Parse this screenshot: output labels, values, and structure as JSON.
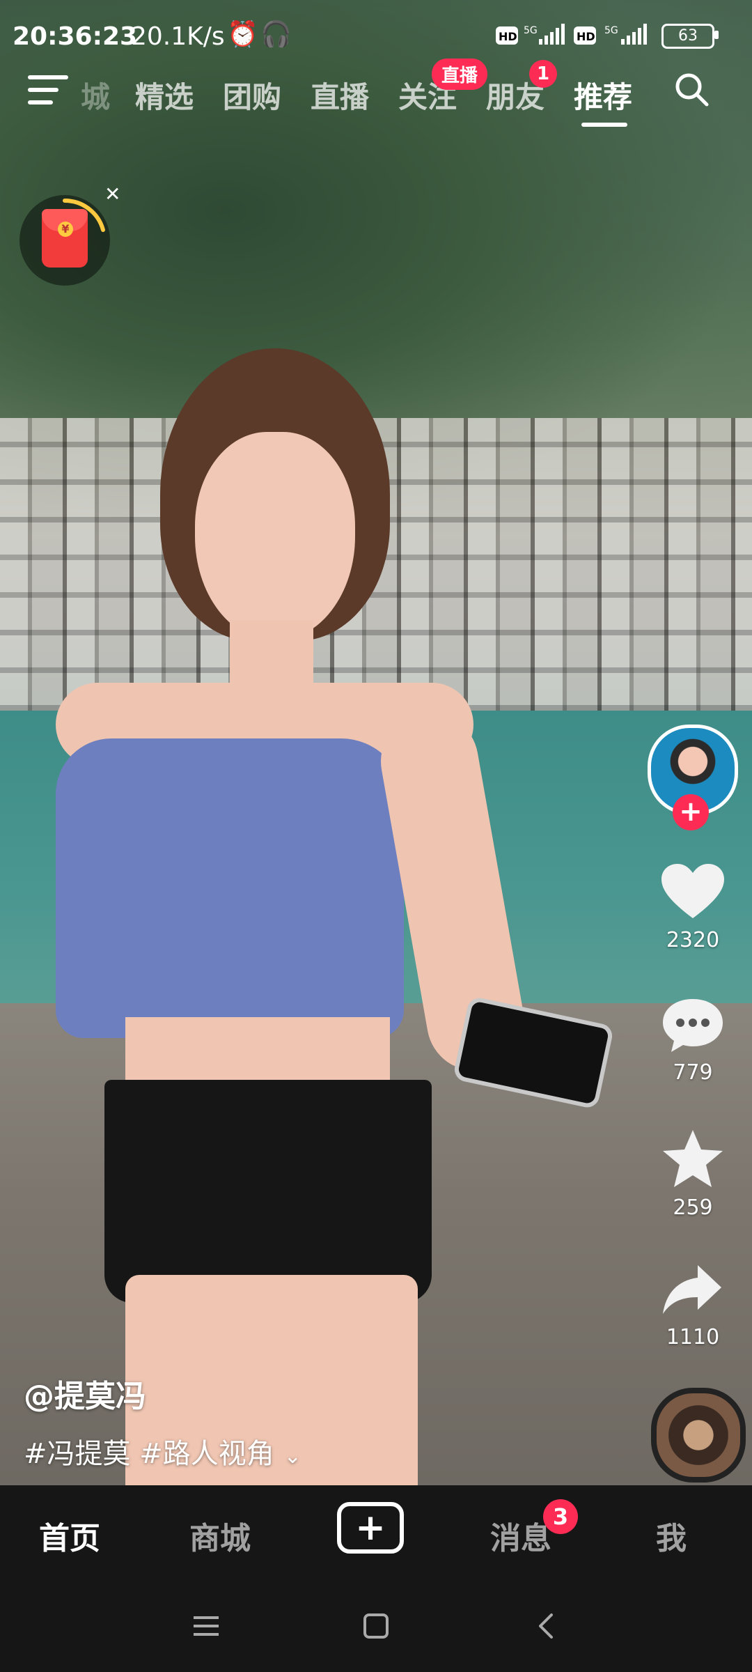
{
  "status_bar": {
    "time": "20:36:23",
    "speed": "20.1K/s",
    "battery": "63",
    "icons": [
      "alarm-icon",
      "headset-icon",
      "hd-icon",
      "signal-5g-icon",
      "hd-icon",
      "signal-5g-icon",
      "battery-icon"
    ]
  },
  "top_nav": {
    "tabs": [
      {
        "label": "城",
        "state": "faded"
      },
      {
        "label": "精选",
        "state": "normal"
      },
      {
        "label": "团购",
        "state": "normal"
      },
      {
        "label": "直播",
        "state": "normal"
      },
      {
        "label": "关注",
        "state": "normal"
      },
      {
        "label": "朋友",
        "state": "normal"
      },
      {
        "label": "推荐",
        "state": "active"
      }
    ],
    "live_badge": "直播",
    "friends_badge": "1"
  },
  "actions": {
    "likes": "2320",
    "comments": "779",
    "favorites": "259",
    "shares": "1110"
  },
  "caption": {
    "author": "@提莫冯",
    "tags": "#冯提莫 #路人视角"
  },
  "tab_bar": {
    "home": "首页",
    "mall": "商城",
    "create": "+",
    "messages": "消息",
    "messages_badge": "3",
    "me": "我"
  },
  "colors": {
    "accent": "#fe2c55",
    "tab_bar_bg": "#161616"
  }
}
